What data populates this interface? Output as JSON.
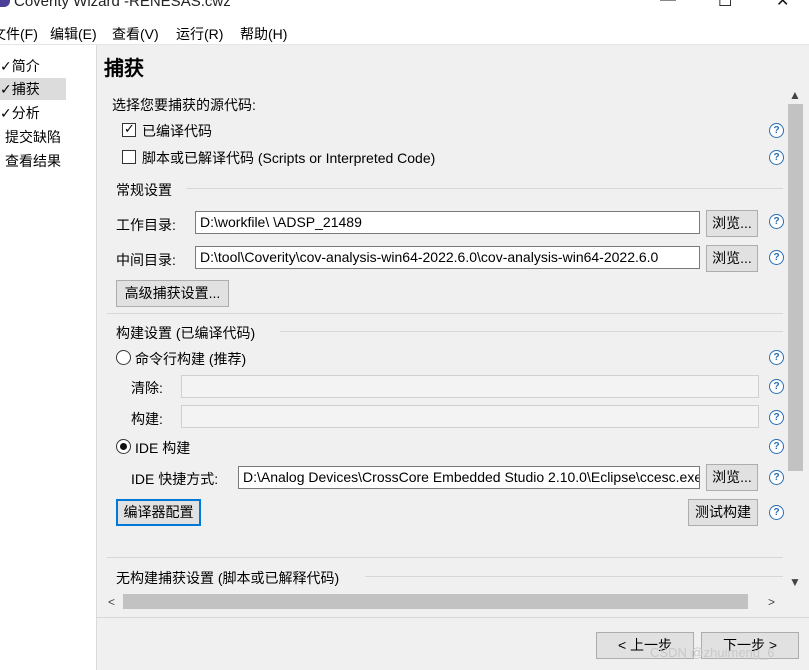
{
  "window": {
    "title": "Coverity Wizard -RENESAS.cwz",
    "min": "—",
    "max": "☐",
    "close": "✕"
  },
  "menu": [
    {
      "label": "文件(F)"
    },
    {
      "label": "编辑(E)"
    },
    {
      "label": "查看(V)"
    },
    {
      "label": "运行(R)"
    },
    {
      "label": "帮助(H)"
    }
  ],
  "nav": [
    {
      "label": "简介"
    },
    {
      "label": "捕获"
    },
    {
      "label": "分析"
    },
    {
      "label": "提交缺陷"
    },
    {
      "label": "查看结果"
    }
  ],
  "page": {
    "title": "捕获",
    "source_prompt": "选择您要捕获的源代码:",
    "compiled_label": "已编译代码",
    "compiled_checked": true,
    "scripts_label": "脚本或已解译代码 (Scripts or Interpreted Code)",
    "scripts_checked": false,
    "general_group": "常规设置",
    "workdir_label": "工作目录:",
    "workdir_value": "D:\\workfile\\      \\ADSP_21489",
    "tempdir_label": "中间目录:",
    "tempdir_value": "D:\\tool\\Coverity\\cov-analysis-win64-2022.6.0\\cov-analysis-win64-2022.6.0",
    "browse_label": "浏览...",
    "advanced_label": "高级捕获设置...",
    "build_group": "构建设置 (已编译代码)",
    "cmdline_label": "命令行构建 (推荐)",
    "clean_label": "清除:",
    "build_label": "构建:",
    "ide_label": "IDE 构建",
    "ide_shortcut_label": "IDE 快捷方式:",
    "ide_shortcut_value": "D:\\Analog Devices\\CrossCore Embedded Studio 2.10.0\\Eclipse\\ccesc.exe",
    "compiler_config_label": "编译器配置",
    "test_build_label": "测试构建",
    "nobuild_group": "无构建捕获设置 (脚本或已解释代码)",
    "help_glyph": "?"
  },
  "footer": {
    "prev_label": "< 上一步",
    "next_label": "下一步 >",
    "watermark": "CSDN @zhuimeng_6"
  }
}
